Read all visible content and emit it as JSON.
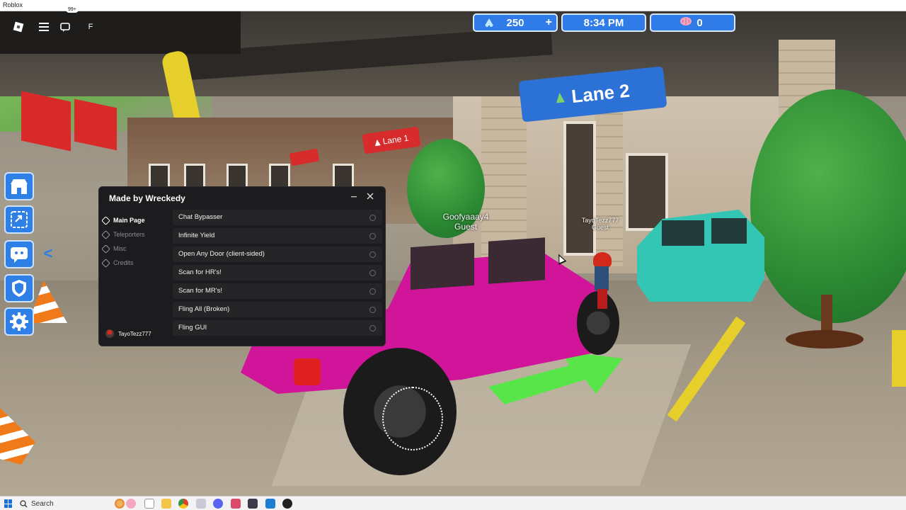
{
  "window": {
    "title": "Roblox"
  },
  "topbar": {
    "chat_badge": "99+",
    "f_label": "F"
  },
  "hud": {
    "currency_value": "250",
    "currency_add": "+",
    "time": "8:34 PM",
    "brains_value": "0"
  },
  "world": {
    "lane2_sign": "Lane 2",
    "lane1_sign": "Lane 1",
    "player1_name": "Goofyaaay4",
    "player1_role": "Guest",
    "player2_name": "TayoTezz777",
    "player2_role": "Guest"
  },
  "side_menu": {
    "collapse_arrow": "<",
    "items": [
      "shop-icon",
      "shortcut-icon",
      "chat-face-icon",
      "shield-icon",
      "gear-icon"
    ]
  },
  "gui": {
    "title": "Made by Wreckedy",
    "nav": [
      {
        "label": "Main Page",
        "active": true
      },
      {
        "label": "Teleporters",
        "active": false
      },
      {
        "label": "Misc",
        "active": false
      },
      {
        "label": "Credits",
        "active": false
      }
    ],
    "username": "TayoTezz777",
    "buttons": [
      "Chat Bypasser",
      "Infinite Yield",
      "Open Any Door (client-sided)",
      "Scan for HR's!",
      "Scan for MR's!",
      "Fling All (Broken)",
      "Fling GUI"
    ]
  },
  "taskbar": {
    "search_label": "Search"
  },
  "colors": {
    "hud_blue": "#2f7be8",
    "panel_bg": "#1c1c1e",
    "jeep_pink": "#d1159b"
  }
}
